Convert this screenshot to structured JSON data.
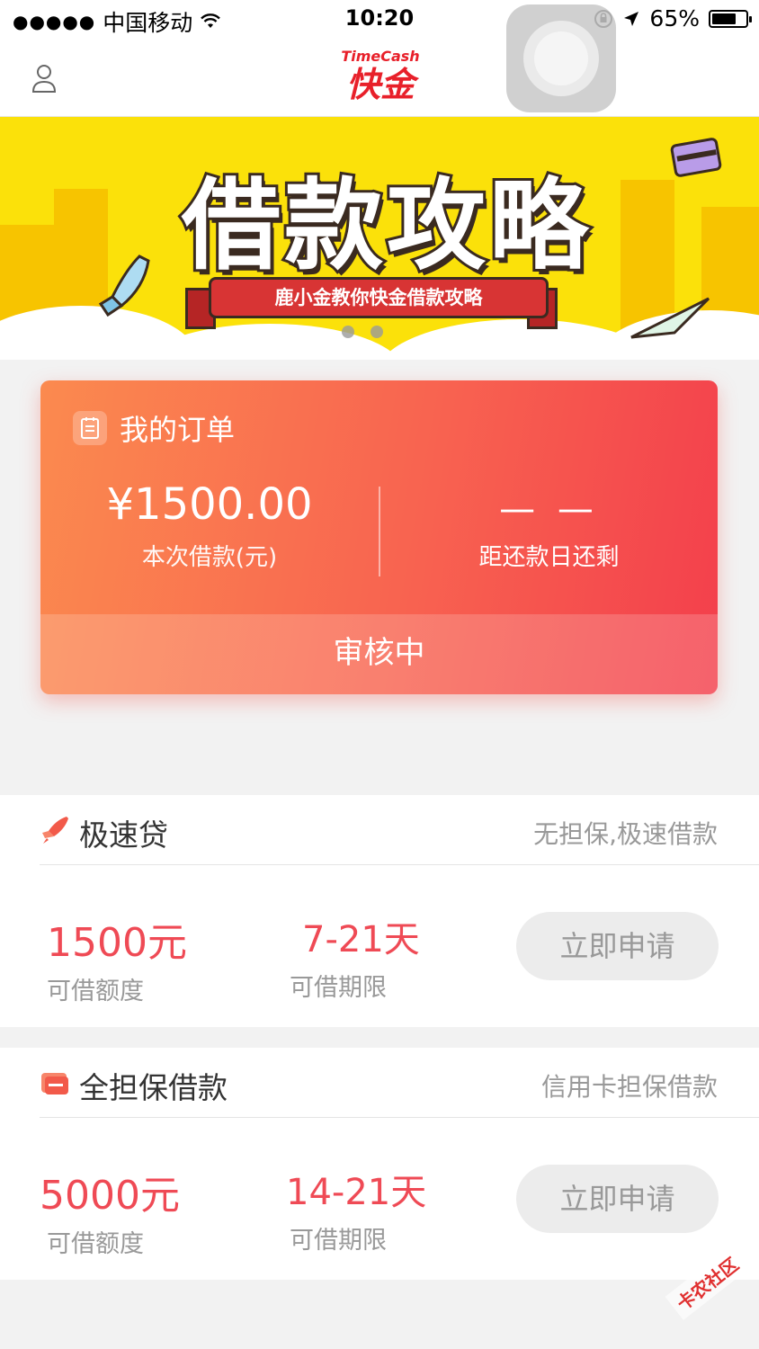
{
  "status_bar": {
    "carrier": "中国移动",
    "time": "10:20",
    "battery": "65%"
  },
  "nav": {
    "logo_en": "TimeCash",
    "logo_zh": "快金"
  },
  "banner": {
    "title": "借款攻略",
    "subtitle": "鹿小金教你快金借款攻略"
  },
  "order": {
    "title": "我的订单",
    "amount": "¥1500.00",
    "amount_label": "本次借款(元)",
    "days_value": "— —",
    "days_label": "距还款日还剩",
    "status": "审核中"
  },
  "loans": [
    {
      "title": "极速贷",
      "subtitle": "无担保,极速借款",
      "amount": "1500元",
      "amount_label": "可借额度",
      "term": "7-21天",
      "term_label": "可借期限",
      "button": "立即申请"
    },
    {
      "title": "全担保借款",
      "subtitle": "信用卡担保借款",
      "amount": "5000元",
      "amount_label": "可借额度",
      "term": "14-21天",
      "term_label": "可借期限",
      "button": "立即申请"
    }
  ],
  "watermark": "卡农社区",
  "colors": {
    "accent": "#ef4a55",
    "card_start": "#fb8a4f",
    "card_end": "#f33f4c",
    "banner": "#fbe10a"
  }
}
